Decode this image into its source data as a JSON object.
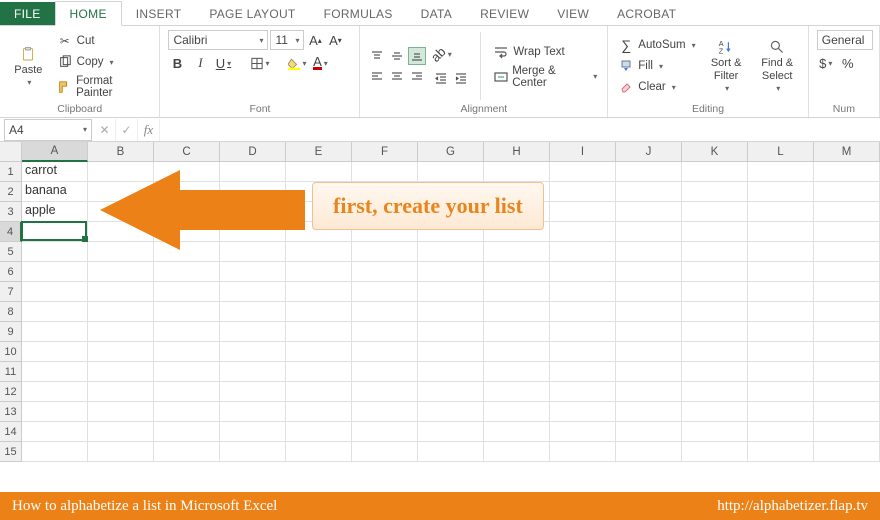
{
  "tabs": [
    "FILE",
    "HOME",
    "INSERT",
    "PAGE LAYOUT",
    "FORMULAS",
    "DATA",
    "REVIEW",
    "VIEW",
    "ACROBAT"
  ],
  "active_tab": "HOME",
  "clipboard": {
    "paste": "Paste",
    "cut": "Cut",
    "copy": "Copy",
    "format_painter": "Format Painter",
    "label": "Clipboard"
  },
  "font": {
    "name": "Calibri",
    "size": "11",
    "label": "Font"
  },
  "alignment": {
    "wrap": "Wrap Text",
    "merge": "Merge & Center",
    "label": "Alignment"
  },
  "editing": {
    "autosum": "AutoSum",
    "fill": "Fill",
    "clear": "Clear",
    "sort": "Sort & Filter",
    "find": "Find & Select",
    "label": "Editing"
  },
  "number": {
    "format": "General",
    "label": "Num"
  },
  "name_box": "A4",
  "columns": [
    "A",
    "B",
    "C",
    "D",
    "E",
    "F",
    "G",
    "H",
    "I",
    "J",
    "K",
    "L",
    "M"
  ],
  "row_count": 15,
  "cells": {
    "A1": "carrot",
    "A2": "banana",
    "A3": "apple"
  },
  "active_cell": {
    "col": 0,
    "row": 3
  },
  "callout_text": "first, create your list",
  "footer_left": "How to alphabetize a list in Microsoft Excel",
  "footer_right": "http://alphabetizer.flap.tv",
  "colors": {
    "accent": "#217346",
    "orange": "#ec8217"
  }
}
